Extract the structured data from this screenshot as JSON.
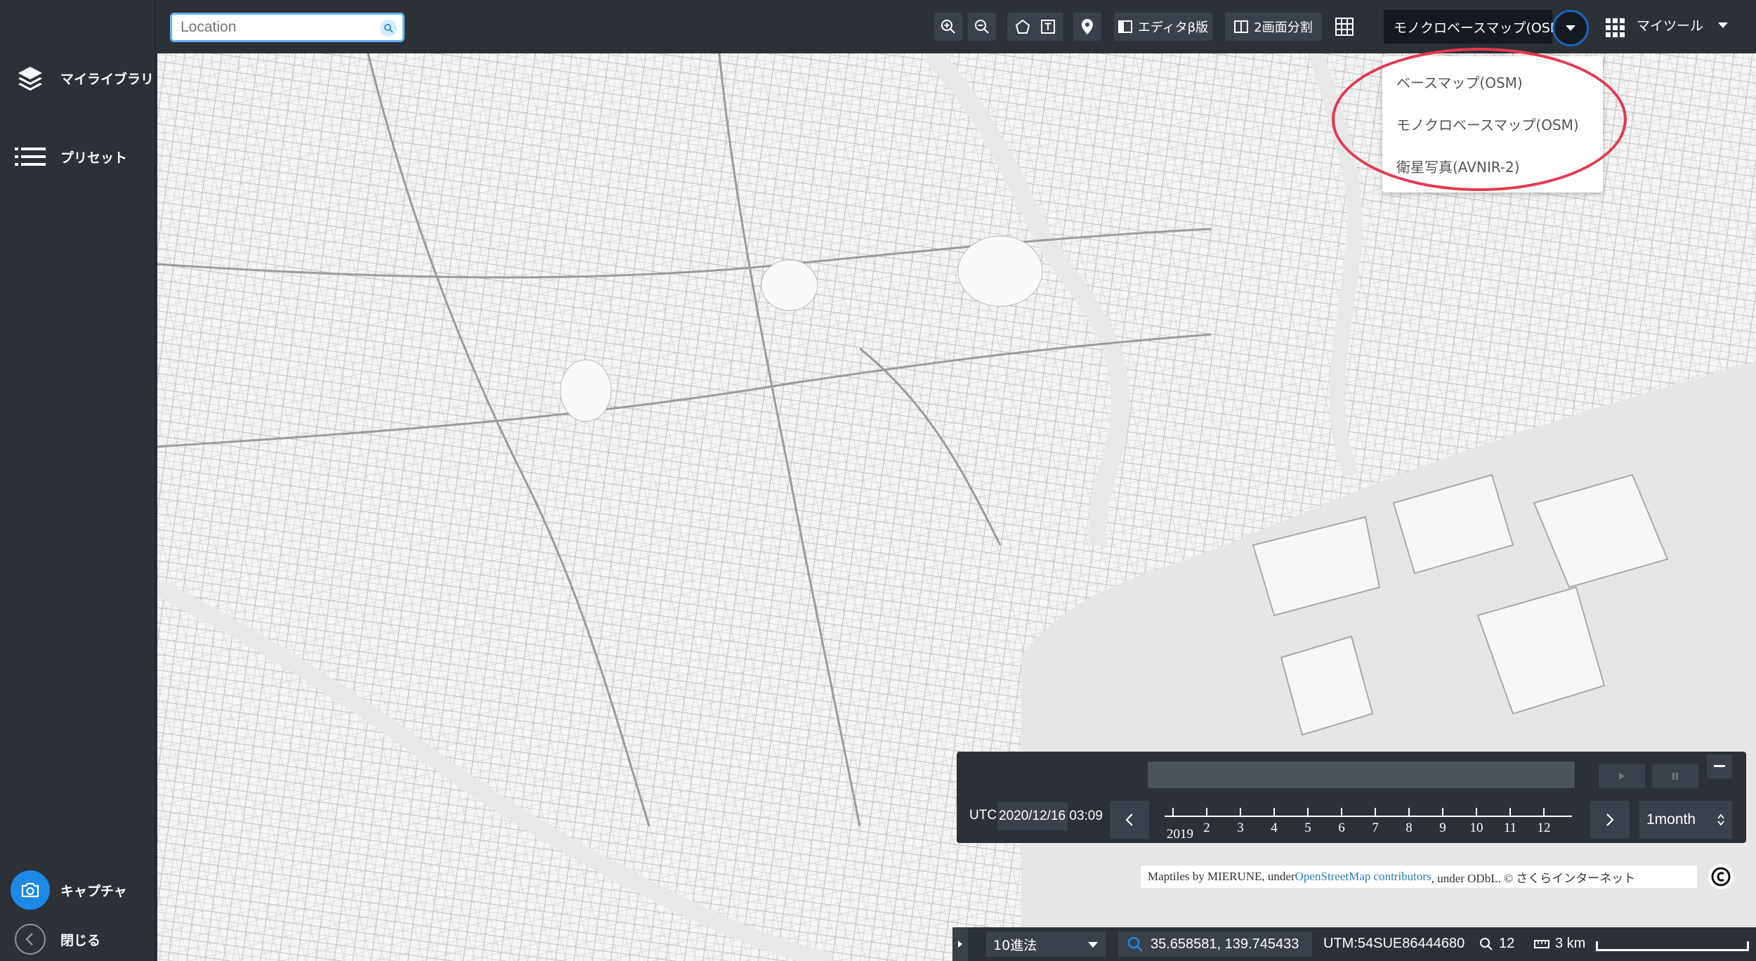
{
  "sidebar": {
    "items": [
      {
        "label": "マイライブラリ",
        "icon": "layers-icon"
      },
      {
        "label": "プリセット",
        "icon": "list-icon"
      }
    ],
    "capture_label": "キャプチャ",
    "close_label": "閉じる"
  },
  "search": {
    "placeholder": "Location"
  },
  "toolbar": {
    "editor_label": "エディタβ版",
    "split_label": "2画面分割",
    "basemap_selected": "モノクロベースマップ(OSM)",
    "mytool_label": "マイツール"
  },
  "basemap_menu": {
    "options": [
      "ベースマップ(OSM)",
      "モノクロベースマップ(OSM)",
      "衛星写真(AVNIR-2)"
    ]
  },
  "timeline": {
    "utc_label": "UTC",
    "date": "2020/12/16 03:09",
    "year_label": "2019",
    "months": [
      "2",
      "3",
      "4",
      "5",
      "6",
      "7",
      "8",
      "9",
      "10",
      "11",
      "12"
    ],
    "period": "1month"
  },
  "attribution": {
    "prefix": "Maptiles by MIERUNE, under ",
    "link": "OpenStreetMap contributors",
    "suffix": ", under ODbL. © さくらインターネット"
  },
  "status": {
    "base": "10進法",
    "coords": "35.658581, 139.745433",
    "utm": "UTM:54SUE86444680",
    "zoom": "12",
    "scale": "3 km"
  },
  "colors": {
    "panel": "#2c3138",
    "accent": "#1e88e5",
    "highlight": "#e53950",
    "map_bg": "#f2f2f2"
  }
}
